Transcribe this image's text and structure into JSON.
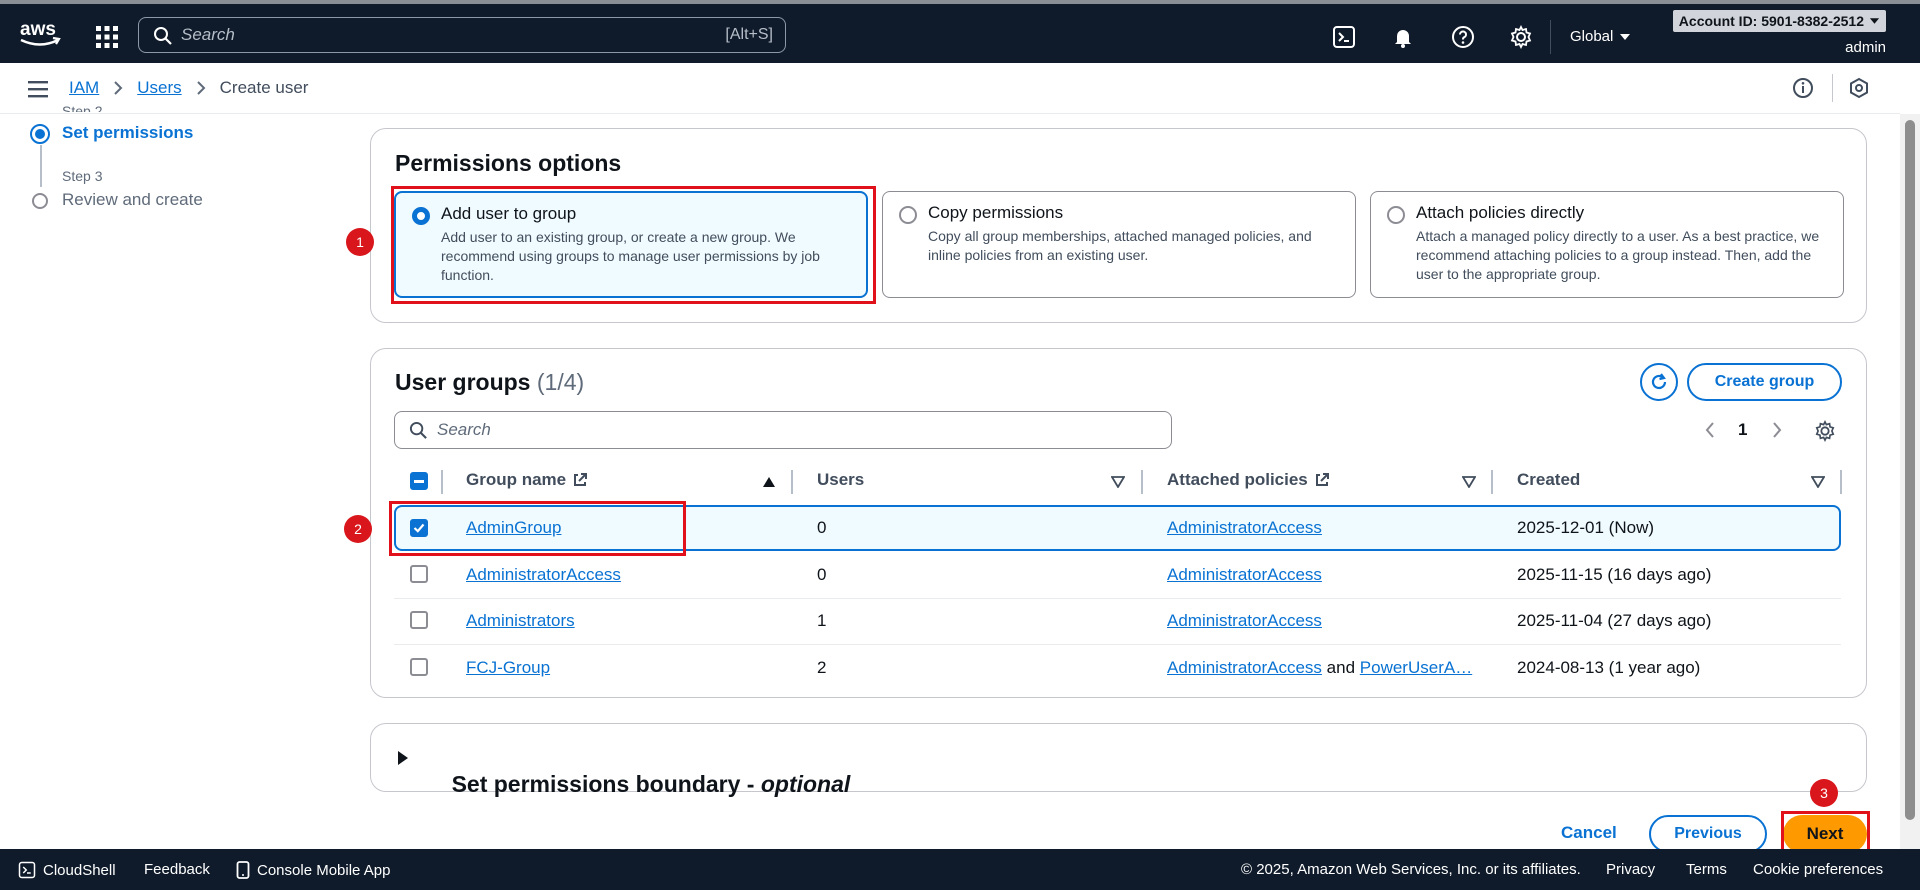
{
  "topnav": {
    "search_placeholder": "Search",
    "search_shortcut": "[Alt+S]",
    "region": "Global",
    "account_id": "Account ID: 5901-8382-2512",
    "user": "admin"
  },
  "breadcrumb": {
    "items": [
      "IAM",
      "Users"
    ],
    "current": "Create user"
  },
  "steps": {
    "step2_label_partial": "Step 2",
    "step2_title": "Set permissions",
    "step3_label": "Step 3",
    "step3_title": "Review and create"
  },
  "permissions": {
    "title": "Permissions options",
    "options": [
      {
        "title": "Add user to group",
        "desc": "Add user to an existing group, or create a new group. We recommend using groups to manage user permissions by job function.",
        "selected": true
      },
      {
        "title": "Copy permissions",
        "desc": "Copy all group memberships, attached managed policies, and inline policies from an existing user.",
        "selected": false
      },
      {
        "title": "Attach policies directly",
        "desc": "Attach a managed policy directly to a user. As a best practice, we recommend attaching policies to a group instead. Then, add the user to the appropriate group.",
        "selected": false
      }
    ]
  },
  "groups": {
    "title": "User groups",
    "count": "(1/4)",
    "create_label": "Create group",
    "search_placeholder": "Search",
    "page": "1",
    "columns": [
      "Group name",
      "Users",
      "Attached policies",
      "Created"
    ],
    "rows": [
      {
        "name": "AdminGroup",
        "users": "0",
        "policy": "AdministratorAccess",
        "created": "2025-12-01 (Now)",
        "checked": true
      },
      {
        "name": "AdministratorAccess",
        "users": "0",
        "policy": "AdministratorAccess",
        "created": "2025-11-15 (16 days ago)",
        "checked": false
      },
      {
        "name": "Administrators",
        "users": "1",
        "policy": "AdministratorAccess",
        "created": "2025-11-04 (27 days ago)",
        "checked": false
      },
      {
        "name": "FCJ-Group",
        "users": "2",
        "policy": "AdministratorAccess",
        "policy_and": "and",
        "policy2": "PowerUserA…",
        "created": "2024-08-13 (1 year ago)",
        "checked": false
      }
    ]
  },
  "boundary": {
    "title": "Set permissions boundary - ",
    "optional": "optional"
  },
  "actions": {
    "cancel": "Cancel",
    "previous": "Previous",
    "next": "Next"
  },
  "badges": [
    "1",
    "2",
    "3"
  ],
  "footer": {
    "cloudshell": "CloudShell",
    "feedback": "Feedback",
    "mobile": "Console Mobile App",
    "copyright": "© 2025, Amazon Web Services, Inc. or its affiliates.",
    "privacy": "Privacy",
    "terms": "Terms",
    "cookies": "Cookie preferences"
  },
  "colors": {
    "nav_bg": "#0f1b2a",
    "link": "#0972d3",
    "primary_button": "#ff9900",
    "annotation_red": "#e0111a"
  }
}
